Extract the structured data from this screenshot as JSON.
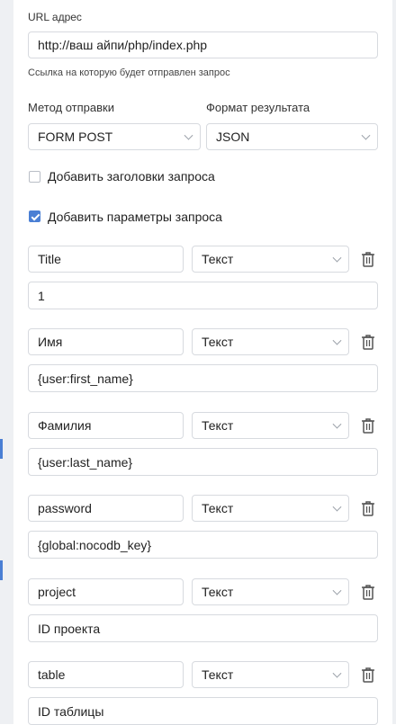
{
  "url": {
    "label": "URL адрес",
    "value": "http://ваш айпи/php/index.php",
    "hint": "Ссылка на которую будет отправлен запрос"
  },
  "method": {
    "label": "Метод отправки",
    "value": "FORM POST"
  },
  "format": {
    "label": "Формат результата",
    "value": "JSON"
  },
  "options": {
    "headers": {
      "label": "Добавить заголовки запроса",
      "checked": false
    },
    "params": {
      "label": "Добавить параметры запроса",
      "checked": true
    }
  },
  "params": [
    {
      "key": "Title",
      "type": "Текст",
      "value": "1"
    },
    {
      "key": "Имя",
      "type": "Текст",
      "value": "{user:first_name}"
    },
    {
      "key": "Фамилия",
      "type": "Текст",
      "value": "{user:last_name}"
    },
    {
      "key": "password",
      "type": "Текст",
      "value": "{global:nocodb_key}"
    },
    {
      "key": "project",
      "type": "Текст",
      "value": "ID проекта"
    },
    {
      "key": "table",
      "type": "Текст",
      "value": "ID таблицы"
    }
  ],
  "colors": {
    "accent": "#4a7fd4",
    "border": "#d7dadf"
  },
  "icons": {
    "delete": "trash-icon",
    "dropdown": "chevron-down-icon"
  }
}
